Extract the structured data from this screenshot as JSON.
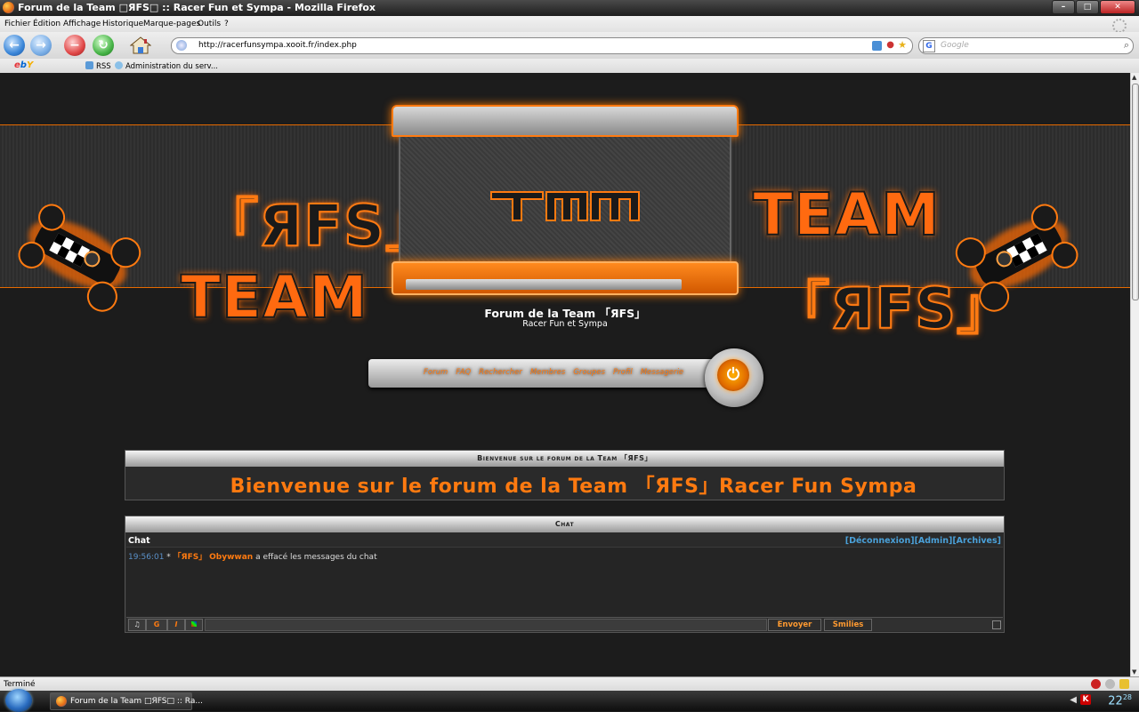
{
  "window": {
    "title": "Forum de la Team □ЯFS□ :: Racer Fun et Sympa - Mozilla Firefox",
    "min": "–",
    "max": "□",
    "close": "✕"
  },
  "menu": [
    "Fichier",
    "Édition",
    "Affichage",
    "Historique",
    "Marque-pages",
    "Outils",
    "?"
  ],
  "address": {
    "url": "http://racerfunsympa.xooit.fr/index.php"
  },
  "search": {
    "placeholder": "Google"
  },
  "bookmarks": {
    "ebay": {
      "e": "e",
      "b": "b",
      "y": "Y"
    },
    "items": [
      "RSS",
      "Administration du serv..."
    ]
  },
  "banner": {
    "rfs_left": "「ЯFS」",
    "team_left": "TEAM",
    "team_right": "TEAM",
    "rfs_right": "「ЯFS」"
  },
  "forum": {
    "title": "Forum de la Team 「ЯFS」",
    "subtitle": "Racer Fun et Sympa"
  },
  "site_nav": {
    "links": [
      "Forum",
      "FAQ",
      "Rechercher",
      "Membres",
      "Groupes",
      "Profil",
      "Messagerie"
    ]
  },
  "welcome": {
    "header": "Bienvenue sur le forum de la Team 「ЯFS」",
    "message": "Bienvenue sur le forum de la Team 「ЯFS」Racer Fun Sympa"
  },
  "chat": {
    "header": "Chat",
    "label": "Chat",
    "links": [
      "[Déconnexion]",
      "[Admin]",
      "[Archives]"
    ],
    "messages": [
      {
        "time": "19:56:01",
        "star": "*",
        "tag": "「ЯFS」",
        "nick": "Obywwan",
        "text": "a effacé les messages du chat"
      }
    ],
    "toolbar": {
      "bold": "G",
      "italic": "I"
    },
    "send": "Envoyer",
    "smilies": "Smilies"
  },
  "status": {
    "text": "Terminé"
  },
  "taskbar": {
    "item": "Forum de la Team □ЯFS□ :: Ra...",
    "clock_h": "22",
    "clock_m": "28"
  },
  "colors": {
    "accent": "#ff7a10",
    "link": "#4aa0d8",
    "bg": "#1c1c1c"
  }
}
